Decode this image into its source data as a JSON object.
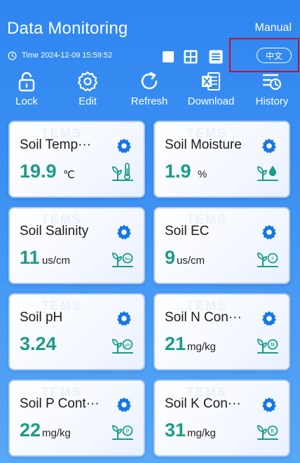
{
  "header": {
    "title": "Data Monitoring",
    "mode_label": "Manual"
  },
  "status": {
    "time_label": "Time 2024-12-09 15:59:52",
    "language_button": "中文"
  },
  "toolbar": [
    {
      "label": "Lock",
      "icon": "lock-icon"
    },
    {
      "label": "Edit",
      "icon": "gear-icon"
    },
    {
      "label": "Refresh",
      "icon": "refresh-icon"
    },
    {
      "label": "Download",
      "icon": "excel-icon"
    },
    {
      "label": "History",
      "icon": "history-icon"
    }
  ],
  "colors": {
    "accent": "#1c9a8a",
    "primary": "#2f86f0",
    "highlight": "#c8102e"
  },
  "cards": [
    {
      "name": "Soil Temp···",
      "value": "19.9",
      "unit": "℃",
      "icon": "thermometer-plant-icon"
    },
    {
      "name": "Soil Moisture",
      "value": "1.9",
      "unit": "%",
      "icon": "water-drop-plant-icon"
    },
    {
      "name": "Soil Salinity",
      "value": "11",
      "unit": "us/cm",
      "icon": "na-plant-icon"
    },
    {
      "name": "Soil EC",
      "value": "9",
      "unit": "us/cm",
      "icon": "ec-plant-icon"
    },
    {
      "name": "Soil pH",
      "value": "3.24",
      "unit": "",
      "icon": "ph-plant-icon"
    },
    {
      "name": "Soil N Con···",
      "value": "21",
      "unit": "mg/kg",
      "icon": "n-plant-icon"
    },
    {
      "name": "Soil P Cont···",
      "value": "22",
      "unit": "mg/kg",
      "icon": "p-plant-icon"
    },
    {
      "name": "Soil K Con···",
      "value": "31",
      "unit": "mg/kg",
      "icon": "k-plant-icon"
    }
  ]
}
